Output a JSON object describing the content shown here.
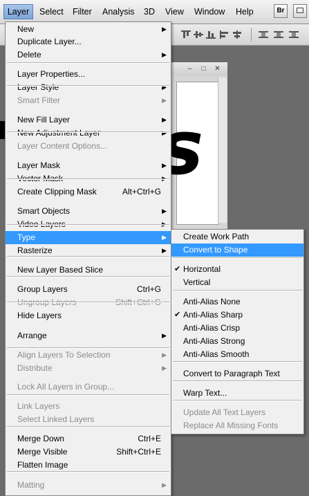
{
  "menubar": {
    "items": [
      "Layer",
      "Select",
      "Filter",
      "Analysis",
      "3D",
      "View",
      "Window",
      "Help"
    ],
    "bridge_label": "Br"
  },
  "main_menu": {
    "items": [
      {
        "label": "New",
        "shortcut": "",
        "submenu": true,
        "disabled": false
      },
      {
        "label": "Duplicate Layer...",
        "shortcut": "",
        "submenu": false,
        "disabled": false
      },
      {
        "label": "Delete",
        "shortcut": "",
        "submenu": true,
        "disabled": false
      },
      {
        "label": "Layer Properties...",
        "shortcut": "",
        "submenu": false,
        "disabled": false
      },
      {
        "label": "Layer Style",
        "shortcut": "",
        "submenu": true,
        "disabled": false
      },
      {
        "label": "Smart Filter",
        "shortcut": "",
        "submenu": true,
        "disabled": true
      },
      {
        "label": "New Fill Layer",
        "shortcut": "",
        "submenu": true,
        "disabled": false
      },
      {
        "label": "New Adjustment Layer",
        "shortcut": "",
        "submenu": true,
        "disabled": false
      },
      {
        "label": "Layer Content Options...",
        "shortcut": "",
        "submenu": false,
        "disabled": true
      },
      {
        "label": "Layer Mask",
        "shortcut": "",
        "submenu": true,
        "disabled": false
      },
      {
        "label": "Vector Mask",
        "shortcut": "",
        "submenu": true,
        "disabled": false
      },
      {
        "label": "Create Clipping Mask",
        "shortcut": "Alt+Ctrl+G",
        "submenu": false,
        "disabled": false
      },
      {
        "label": "Smart Objects",
        "shortcut": "",
        "submenu": true,
        "disabled": false
      },
      {
        "label": "Video Layers",
        "shortcut": "",
        "submenu": true,
        "disabled": false
      },
      {
        "label": "Type",
        "shortcut": "",
        "submenu": true,
        "disabled": false
      },
      {
        "label": "Rasterize",
        "shortcut": "",
        "submenu": true,
        "disabled": false
      },
      {
        "label": "New Layer Based Slice",
        "shortcut": "",
        "submenu": false,
        "disabled": false
      },
      {
        "label": "Group Layers",
        "shortcut": "Ctrl+G",
        "submenu": false,
        "disabled": false
      },
      {
        "label": "Ungroup Layers",
        "shortcut": "Shift+Ctrl+G",
        "submenu": false,
        "disabled": true
      },
      {
        "label": "Hide Layers",
        "shortcut": "",
        "submenu": false,
        "disabled": false
      },
      {
        "label": "Arrange",
        "shortcut": "",
        "submenu": true,
        "disabled": false
      },
      {
        "label": "Align Layers To Selection",
        "shortcut": "",
        "submenu": true,
        "disabled": true
      },
      {
        "label": "Distribute",
        "shortcut": "",
        "submenu": true,
        "disabled": true
      },
      {
        "label": "Lock All Layers in Group...",
        "shortcut": "",
        "submenu": false,
        "disabled": true
      },
      {
        "label": "Link Layers",
        "shortcut": "",
        "submenu": false,
        "disabled": true
      },
      {
        "label": "Select Linked Layers",
        "shortcut": "",
        "submenu": false,
        "disabled": true
      },
      {
        "label": "Merge Down",
        "shortcut": "Ctrl+E",
        "submenu": false,
        "disabled": false
      },
      {
        "label": "Merge Visible",
        "shortcut": "Shift+Ctrl+E",
        "submenu": false,
        "disabled": false
      },
      {
        "label": "Flatten Image",
        "shortcut": "",
        "submenu": false,
        "disabled": false
      },
      {
        "label": "Matting",
        "shortcut": "",
        "submenu": true,
        "disabled": true
      }
    ]
  },
  "type_menu": {
    "items": [
      {
        "label": "Create Work Path",
        "checked": false,
        "disabled": false
      },
      {
        "label": "Convert to Shape",
        "checked": false,
        "disabled": false
      },
      {
        "label": "Horizontal",
        "checked": true,
        "disabled": false
      },
      {
        "label": "Vertical",
        "checked": false,
        "disabled": false
      },
      {
        "label": "Anti-Alias None",
        "checked": false,
        "disabled": false
      },
      {
        "label": "Anti-Alias Sharp",
        "checked": true,
        "disabled": false
      },
      {
        "label": "Anti-Alias Crisp",
        "checked": false,
        "disabled": false
      },
      {
        "label": "Anti-Alias Strong",
        "checked": false,
        "disabled": false
      },
      {
        "label": "Anti-Alias Smooth",
        "checked": false,
        "disabled": false
      },
      {
        "label": "Convert to Paragraph Text",
        "checked": false,
        "disabled": false
      },
      {
        "label": "Warp Text...",
        "checked": false,
        "disabled": false
      },
      {
        "label": "Update All Text Layers",
        "checked": false,
        "disabled": true
      },
      {
        "label": "Replace All Missing Fonts",
        "checked": false,
        "disabled": true
      }
    ]
  },
  "document": {
    "letter": "s"
  },
  "colors": {
    "highlight": "#3399ff",
    "menu_bg": "#f0f0f0",
    "disabled_text": "#8b8b8b"
  }
}
